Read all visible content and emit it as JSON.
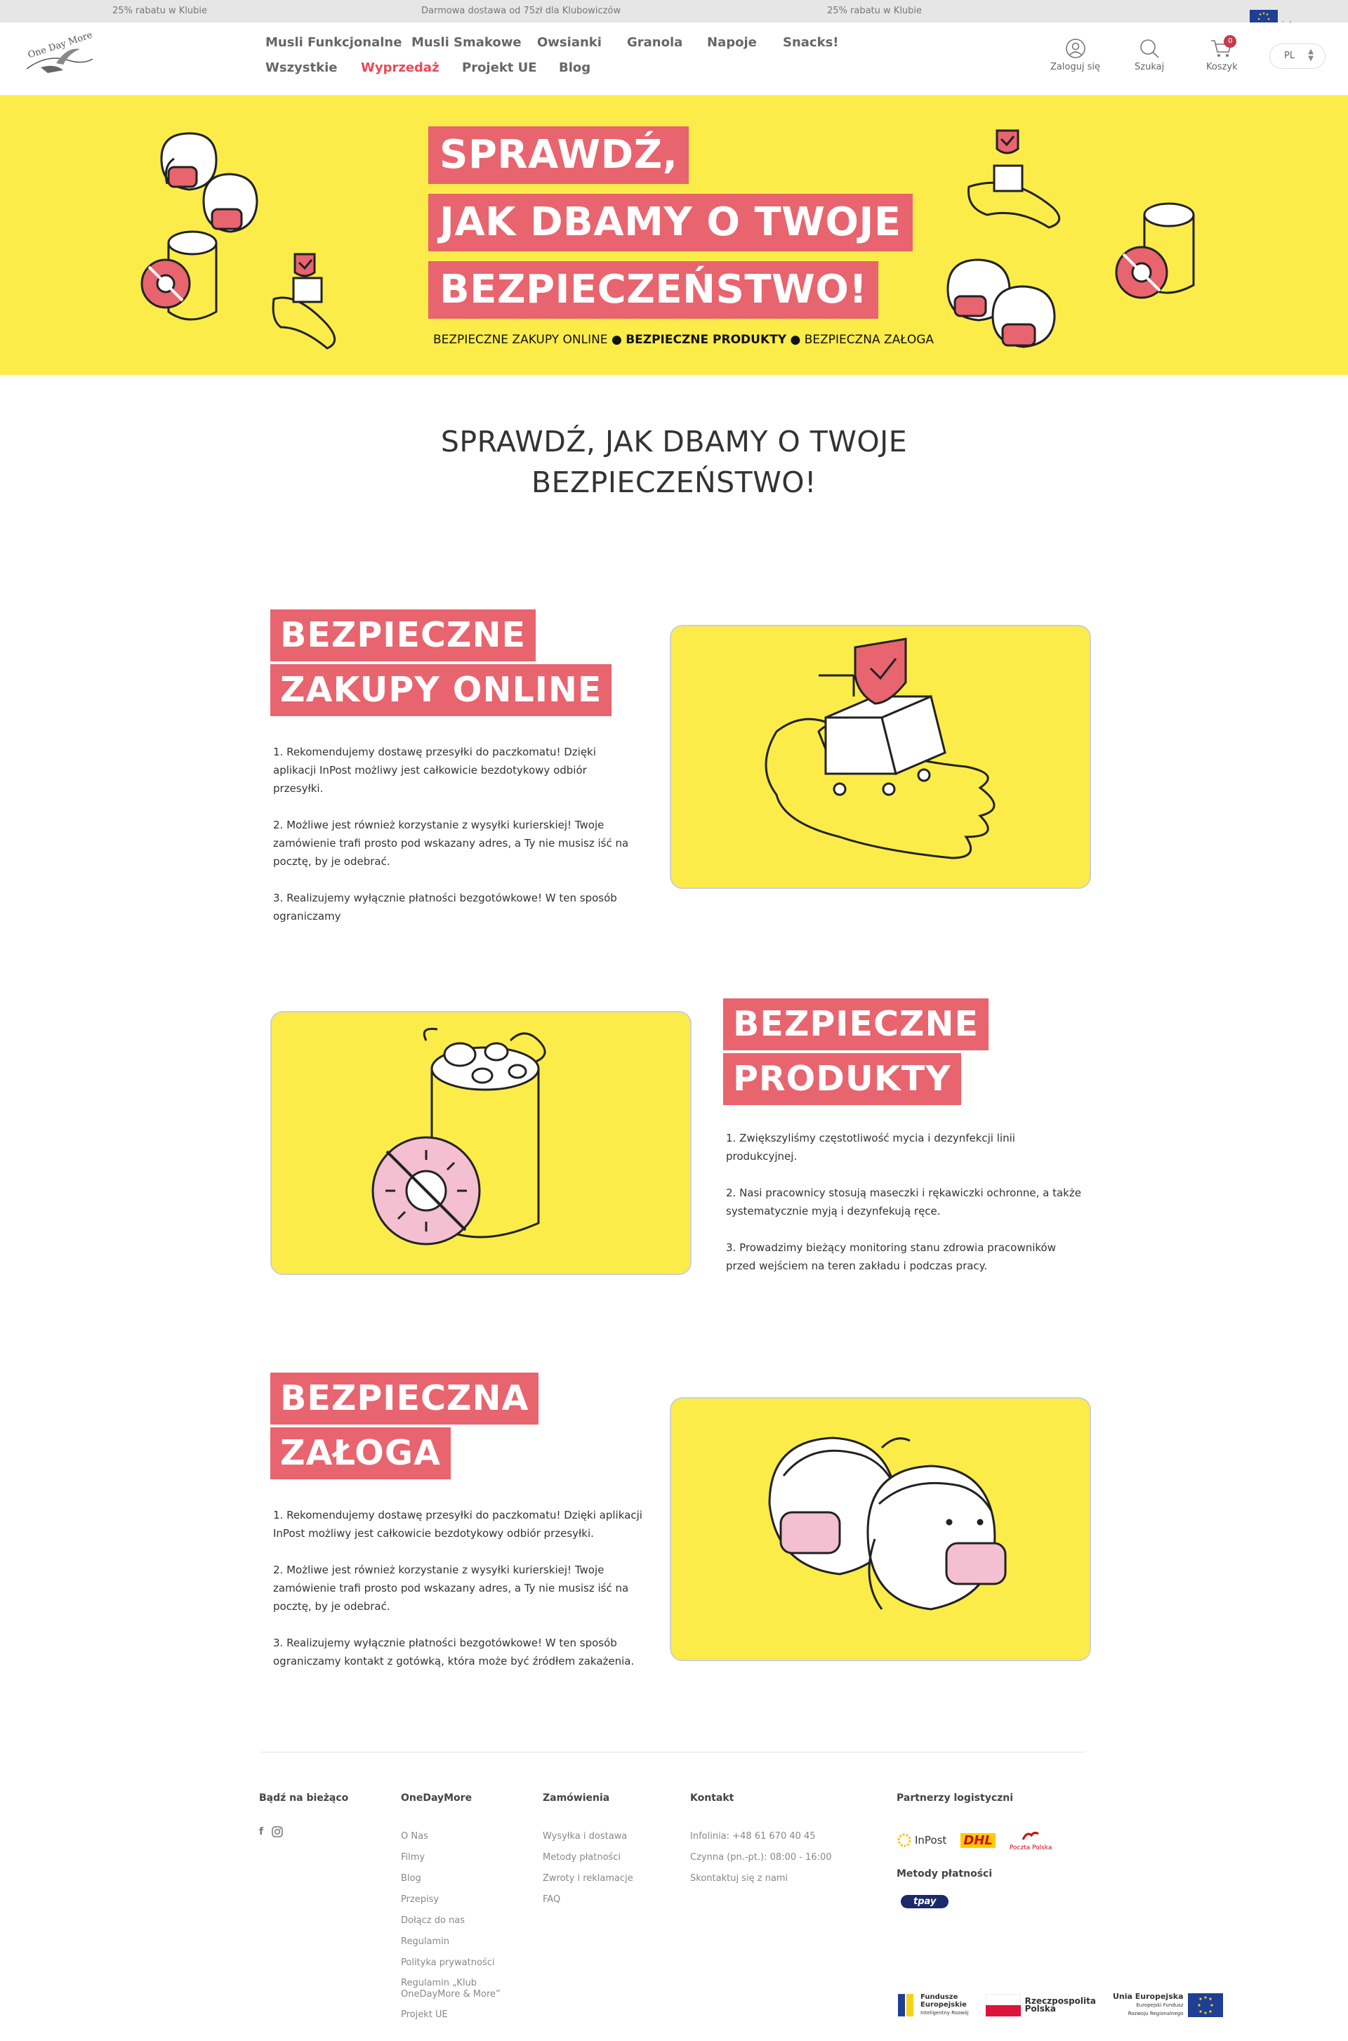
{
  "promo": {
    "left": "25% rabatu w Klubie",
    "mid": "Darmowa dostawa od 75zł dla Klubowiczów",
    "right": "25% rabatu w Klubie",
    "eu": "Unia Europejska"
  },
  "nav": {
    "items": [
      "Musli Funkcjonalne",
      "Musli Smakowe",
      "Owsianki",
      "Granola",
      "Napoje",
      "Snacks!",
      "Wszystkie",
      "Wyprzedaż",
      "Projekt UE",
      "Blog"
    ]
  },
  "header": {
    "login": "Zaloguj się",
    "search": "Szukaj",
    "cart": "Koszyk",
    "cart_count": "0",
    "lang": "PL"
  },
  "hero": {
    "line1": "SPRAWDŹ,",
    "line2": "JAK DBAMY O TWOJE",
    "line3": "BEZPIECZEŃSTWO!",
    "sub1": "BEZPIECZNE ZAKUPY ONLINE ●",
    "sub2": "BEZPIECZNE PRODUKTY",
    "sub3": "● BEZPIECZNA ZAŁOGA"
  },
  "page_title": {
    "line1": "SPRAWDŹ, JAK DBAMY O TWOJE",
    "line2": "BEZPIECZEŃSTWO!"
  },
  "blocks": [
    {
      "tag1": "BEZPIECZNE",
      "tag2": "ZAKUPY ONLINE",
      "p1": "1. Rekomendujemy dostawę przesyłki do paczkomatu! Dzięki aplikacji InPost możliwy jest całkowicie bezdotykowy odbiór przesyłki.",
      "p2": "2. Możliwe jest również korzystanie z wysyłki kurierskiej! Twoje zamówienie trafi prosto pod wskazany adres, a Ty nie musisz iść na pocztę, by je odebrać.",
      "p3": "3. Realizujemy wyłącznie płatności bezgotówkowe! W ten sposób ograniczamy"
    },
    {
      "tag1": "BEZPIECZNE",
      "tag2": "PRODUKTY",
      "p1": "1. Zwiększyliśmy częstotliwość mycia i dezynfekcji linii produkcyjnej.",
      "p2": "2. Nasi pracownicy stosują maseczki i rękawiczki ochronne, a także systematycznie myją i dezynfekują ręce.",
      "p3": "3. Prowadzimy bieżący monitoring stanu zdrowia pracowników przed wejściem na teren zakładu i podczas pracy."
    },
    {
      "tag1": "BEZPIECZNA",
      "tag2": "ZAŁOGA",
      "p1": "1. Rekomendujemy dostawę przesyłki do paczkomatu! Dzięki aplikacji InPost możliwy jest całkowicie bezdotykowy odbiór przesyłki.",
      "p2": "2. Możliwe jest również korzystanie z wysyłki kurierskiej! Twoje zamówienie trafi prosto pod wskazany adres, a Ty nie musisz iść na pocztę, by je odebrać.",
      "p3": "3. Realizujemy wyłącznie płatności bezgotówkowe! W ten sposób ograniczamy kontakt z gotówką, która może być źródłem zakażenia."
    }
  ],
  "footer": {
    "follow": "Bądź na bieżąco",
    "col1_title": "OneDayMore",
    "col1": [
      "O Nas",
      "Filmy",
      "Blog",
      "Przepisy",
      "Dołącz do nas",
      "Regulamin",
      "Polityka prywatności",
      "Regulamin „Klub OneDayMore & More”",
      "Projekt UE"
    ],
    "col2_title": "Zamówienia",
    "col2": [
      "Wysyłka i dostawa",
      "Metody płatności",
      "Zwroty i reklamacje",
      "FAQ"
    ],
    "col3_title": "Kontakt",
    "col3": [
      "Infolinia: +48 61 670 40 45",
      "Czynna (pn.-pt.): 08:00 - 16:00",
      "Skontaktuj się z nami"
    ],
    "partners_title": "Partnerzy logistyczni",
    "partners": [
      "InPost",
      "DHL",
      "Poczta Polska"
    ],
    "payments_title": "Metody płatności",
    "payment": "tpay",
    "eu_logos": {
      "fe_1": "Fundusze",
      "fe_2": "Europejskie",
      "fe_3": "Inteligentny Rozwój",
      "rp_1": "Rzeczpospolita",
      "rp_2": "Polska",
      "ue_1": "Unia Europejska",
      "ue_2": "Europejski Fundusz",
      "ue_3": "Rozwoju Regionalnego"
    }
  },
  "colors": {
    "yellow": "#fbec4a",
    "pink": "#e8646e",
    "sale": "#e94957",
    "text": "#333333"
  }
}
